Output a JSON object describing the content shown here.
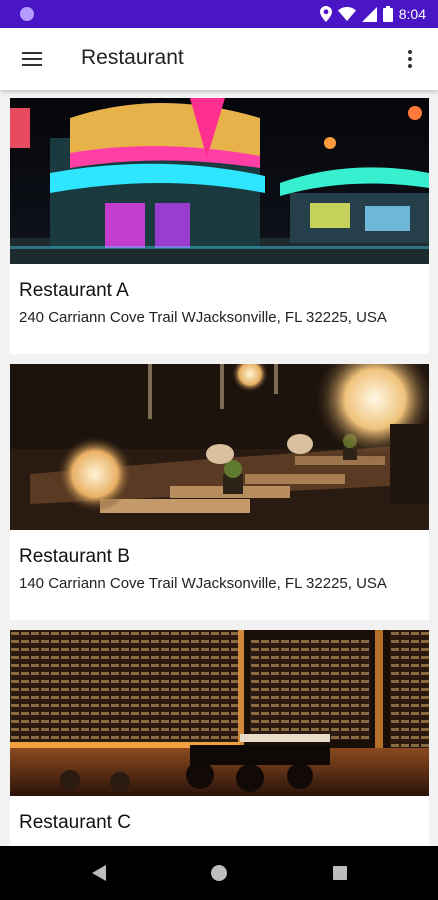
{
  "status_bar": {
    "time": "8:04",
    "background": "#4a15c4",
    "icons": [
      "notification-dot-icon",
      "location-icon",
      "wifi-icon",
      "signal-icon",
      "battery-icon"
    ]
  },
  "app_bar": {
    "title": "Restaurant",
    "icons": [
      "menu-icon",
      "more-vert-icon"
    ]
  },
  "restaurants": [
    {
      "name": "Restaurant A",
      "address": "240 Carriann Cove Trail WJacksonville, FL 32225, USA",
      "image_theme": "neon-diner-exterior-night"
    },
    {
      "name": "Restaurant B",
      "address": "140 Carriann Cove Trail WJacksonville, FL 32225, USA",
      "image_theme": "dim-lounge-pendant-lights"
    },
    {
      "name": "Restaurant C",
      "address": "",
      "image_theme": "wine-cellar-dining-room"
    }
  ],
  "nav_bar": {
    "icons": [
      "back-icon",
      "home-icon",
      "recents-icon"
    ]
  }
}
